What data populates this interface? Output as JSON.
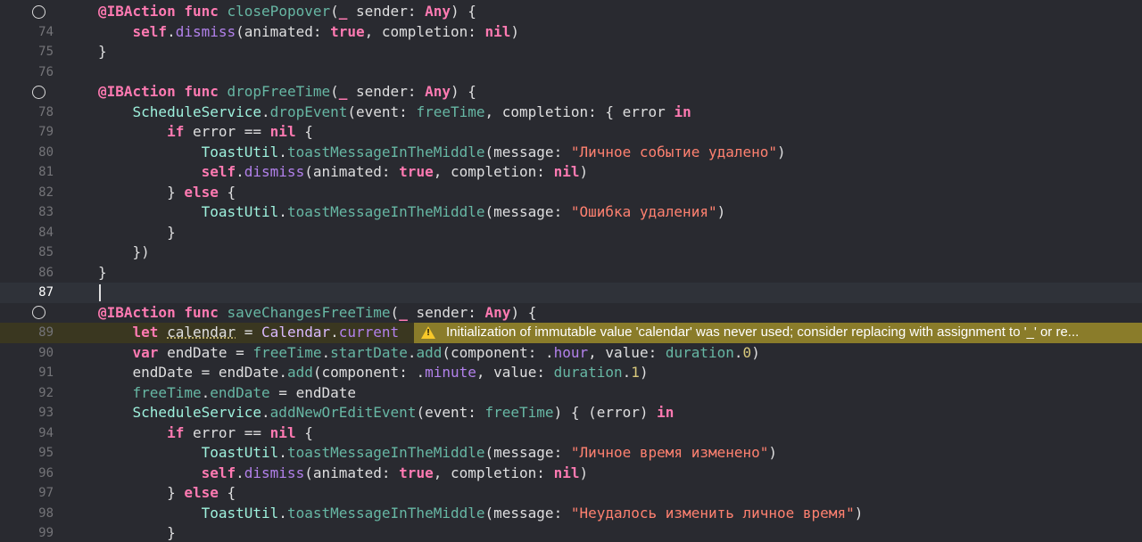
{
  "editor": {
    "language": "Swift",
    "theme_colors": {
      "background": "#292a30",
      "keyword": "#ff7ab2",
      "string": "#ff8170",
      "number": "#d9c97c",
      "type": "#dabaff",
      "project_method": "#67b7a4",
      "plain": "#dfdfe0",
      "warning_bg": "#8a7c2a"
    },
    "lines": [
      {
        "num": "",
        "breakpoint_icon": "method-circle-icon"
      },
      {
        "num": "74"
      },
      {
        "num": "75"
      },
      {
        "num": "76"
      },
      {
        "num": "",
        "breakpoint_icon": "method-circle-icon"
      },
      {
        "num": "78"
      },
      {
        "num": "79"
      },
      {
        "num": "80"
      },
      {
        "num": "81"
      },
      {
        "num": "82"
      },
      {
        "num": "83"
      },
      {
        "num": "84"
      },
      {
        "num": "85"
      },
      {
        "num": "86"
      },
      {
        "num": "87"
      },
      {
        "num": "",
        "breakpoint_icon": "method-circle-icon"
      },
      {
        "num": "89"
      },
      {
        "num": "90"
      },
      {
        "num": "91"
      },
      {
        "num": "92"
      },
      {
        "num": "93"
      },
      {
        "num": "94"
      },
      {
        "num": "95"
      },
      {
        "num": "96"
      },
      {
        "num": "97"
      },
      {
        "num": "98"
      },
      {
        "num": "99"
      }
    ],
    "tokens": {
      "ibaction": "@IBAction",
      "func": "func",
      "sender": " sender: ",
      "any": "Any",
      "self": "self",
      "dismiss": "dismiss",
      "animated": "(animated: ",
      "true": "true",
      "completion": ", completion: ",
      "nil": "nil",
      "close_popover": "closePopover",
      "drop_free_time": "dropFreeTime",
      "save_changes_free_time": "saveChangesFreeTime",
      "schedule_service": "ScheduleService",
      "drop_event": "dropEvent",
      "free_time": "freeTime",
      "error": "error",
      "in": "in",
      "if": "if",
      "else": "else",
      "toast_util": "ToastUtil",
      "toast_method": "toastMessageInTheMiddle",
      "message": "(message: ",
      "str_deleted": "\"Личное событие удалено\"",
      "str_delete_error": "\"Ошибка удаления\"",
      "str_changed": "\"Личное время изменено\"",
      "str_change_failed": "\"Неудалось изменить личное время\"",
      "let": "let",
      "var": "var",
      "calendar_var": "calendar",
      "calendar_type": "Calendar",
      "current": "current",
      "end_date": "endDate",
      "start_date": "startDate",
      "add": "add",
      "hour": "hour",
      "minute": "minute",
      "duration": "duration",
      "zero": "0",
      "one": "1",
      "add_new_or_edit_event": "addNewOrEditEvent"
    },
    "warning": {
      "icon": "warning-triangle-icon",
      "text": "Initialization of immutable value 'calendar' was never used; consider replacing with assignment to '_' or re..."
    }
  }
}
